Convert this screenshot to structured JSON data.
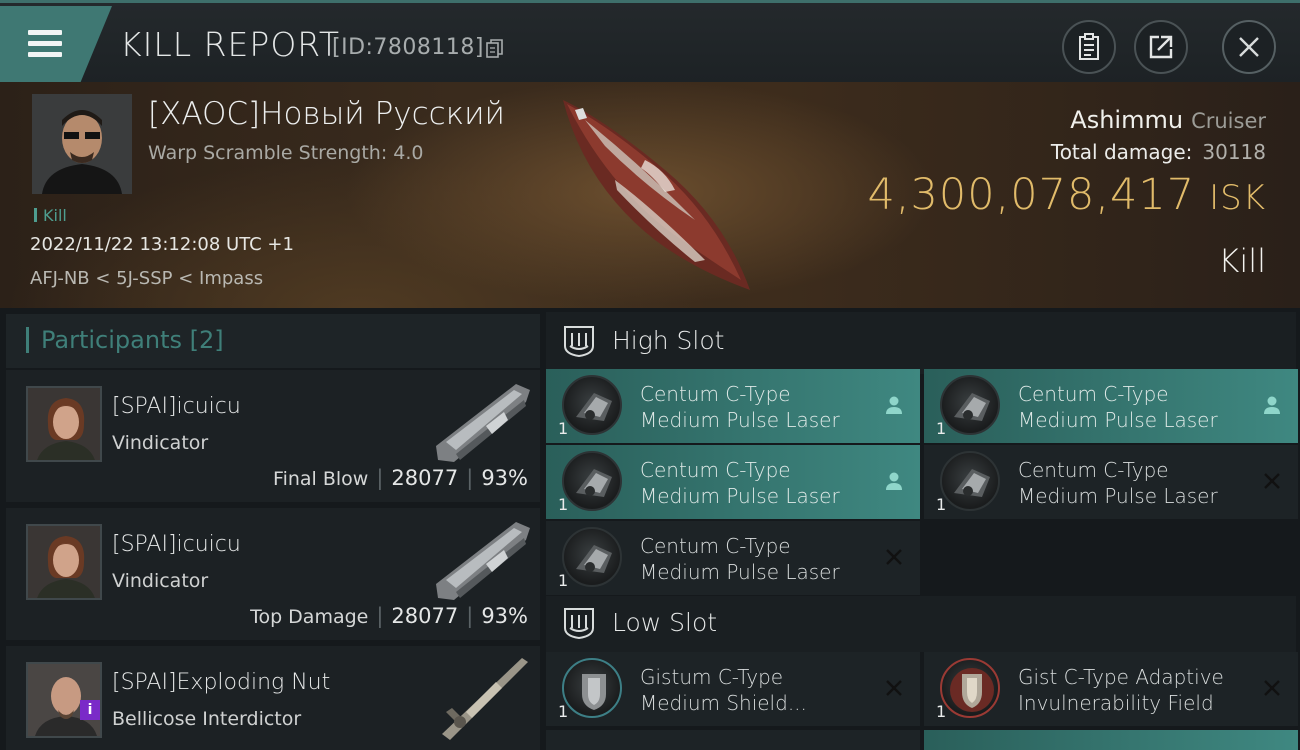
{
  "header": {
    "title": "KILL REPORT",
    "report_id": "[ID:7808118]",
    "icons": [
      "menu-icon",
      "copy-icon",
      "clipboard-icon",
      "share-icon",
      "close-icon"
    ]
  },
  "victim": {
    "pilot_name": "[XAOC]Новый Русский",
    "warp_scramble": "Warp Scramble Strength: 4.0",
    "tag": "Kill",
    "datetime": "2022/11/22 13:12:08 UTC +1",
    "location": "AFJ-NB < 5J-SSP < Impass",
    "ship_name": "Ashimmu",
    "ship_class": "Cruiser",
    "total_damage_label": "Total damage:",
    "total_damage": "30118",
    "isk_value": "4,300,078,417",
    "isk_unit": "ISK",
    "result": "Kill"
  },
  "participants": {
    "label": "Participants [2]",
    "rows": [
      {
        "name": "[SPAI]icuicu",
        "ship": "Vindicator",
        "role": "Final Blow",
        "damage": "28077",
        "percent": "93%"
      },
      {
        "name": "[SPAI]icuicu",
        "ship": "Vindicator",
        "role": "Top Damage",
        "damage": "28077",
        "percent": "93%"
      },
      {
        "name": "[SPAI]Exploding Nut",
        "ship": "Bellicose Interdictor",
        "badge": "i"
      }
    ]
  },
  "slots": {
    "high": {
      "label": "High Slot",
      "modules": [
        {
          "line1": "Centum C-Type",
          "line2": "Medium Pulse Laser",
          "qty": "1",
          "status": "dropped"
        },
        {
          "line1": "Centum C-Type",
          "line2": "Medium Pulse Laser",
          "qty": "1",
          "status": "dropped"
        },
        {
          "line1": "Centum C-Type",
          "line2": "Medium Pulse Laser",
          "qty": "1",
          "status": "dropped"
        },
        {
          "line1": "Centum C-Type",
          "line2": "Medium Pulse Laser",
          "qty": "1",
          "status": "destroyed"
        },
        {
          "line1": "Centum C-Type",
          "line2": "Medium Pulse Laser",
          "qty": "1",
          "status": "destroyed"
        }
      ]
    },
    "low": {
      "label": "Low Slot",
      "modules": [
        {
          "line1": "Gistum C-Type",
          "line2": "Medium Shield...",
          "qty": "1",
          "status": "destroyed"
        },
        {
          "line1": "Gist C-Type Adaptive",
          "line2": "Invulnerability Field",
          "qty": "1",
          "status": "destroyed"
        }
      ]
    }
  },
  "colors": {
    "accent": "#3f7873",
    "isk": "#e1bb6a",
    "highlight": "#3f8881",
    "badge": "#7a2ac8"
  }
}
